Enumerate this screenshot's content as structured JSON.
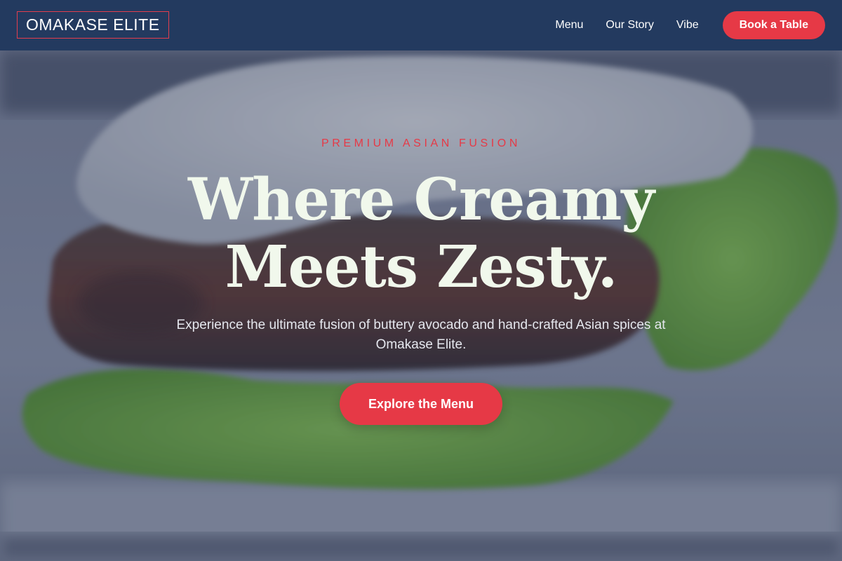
{
  "brand": {
    "name": "OMAKASE ELITE"
  },
  "nav": {
    "links": [
      "Menu",
      "Our Story",
      "Vibe"
    ],
    "cta_label": "Book a Table"
  },
  "hero": {
    "eyebrow": "PREMIUM ASIAN FUSION",
    "headline_line1": "Where Creamy",
    "headline_line2": "Meets Zesty.",
    "subtext": "Experience the ultimate fusion of buttery avocado and hand-crafted Asian spices at Omakase Elite.",
    "cta_label": "Explore the Menu"
  },
  "colors": {
    "header_bg": "#233a5f",
    "accent": "#e63946",
    "headline": "#f1f8ec"
  },
  "icons": []
}
